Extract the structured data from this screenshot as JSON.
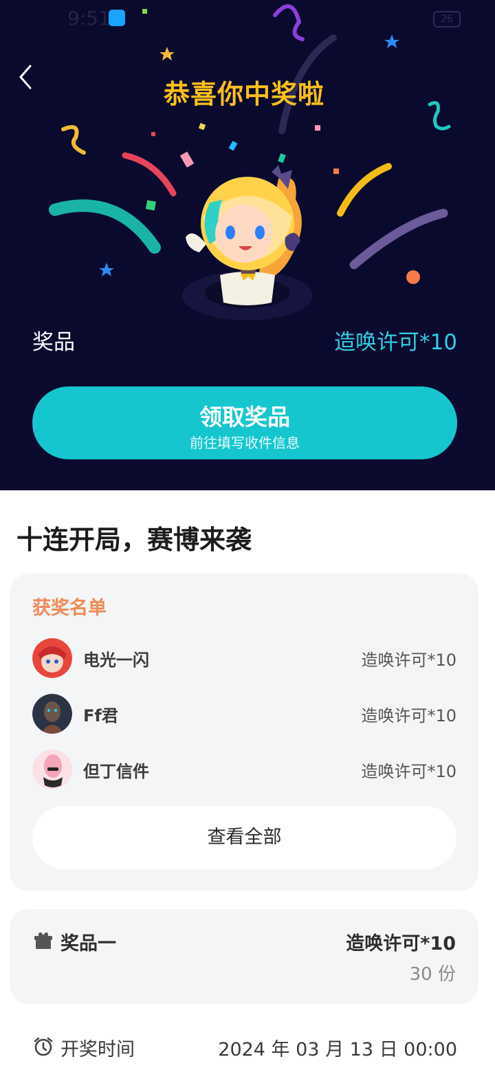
{
  "status_bar": {
    "time": "9:51",
    "battery": "26"
  },
  "hero": {
    "title": "恭喜你中奖啦",
    "prize_label": "奖品",
    "prize_value": "造唤许可*10",
    "claim_button": {
      "title": "领取奖品",
      "subtitle": "前往填写收件信息"
    }
  },
  "event": {
    "title": "十连开局，赛博来袭"
  },
  "winners": {
    "heading": "获奖名单",
    "list": [
      {
        "name": "电光一闪",
        "prize": "造唤许可*10",
        "avatar_color": "#e8453c"
      },
      {
        "name": "Ff君",
        "prize": "造唤许可*10",
        "avatar_color": "#2b3344"
      },
      {
        "name": "但丁信件",
        "prize": "造唤许可*10",
        "avatar_color": "#f3b7c4"
      }
    ],
    "view_all": "查看全部"
  },
  "prize_info": {
    "name": "奖品一",
    "value": "造唤许可*10",
    "count": "30 份"
  },
  "draw_time": {
    "label": "开奖时间",
    "value": "2024 年 03 月 13 日 00:00"
  },
  "colors": {
    "hero_bg": "#0a0a2e",
    "accent_gold": "#ffbf1a",
    "accent_cyan": "#16c6cf",
    "heading_orange": "#f28a55"
  }
}
